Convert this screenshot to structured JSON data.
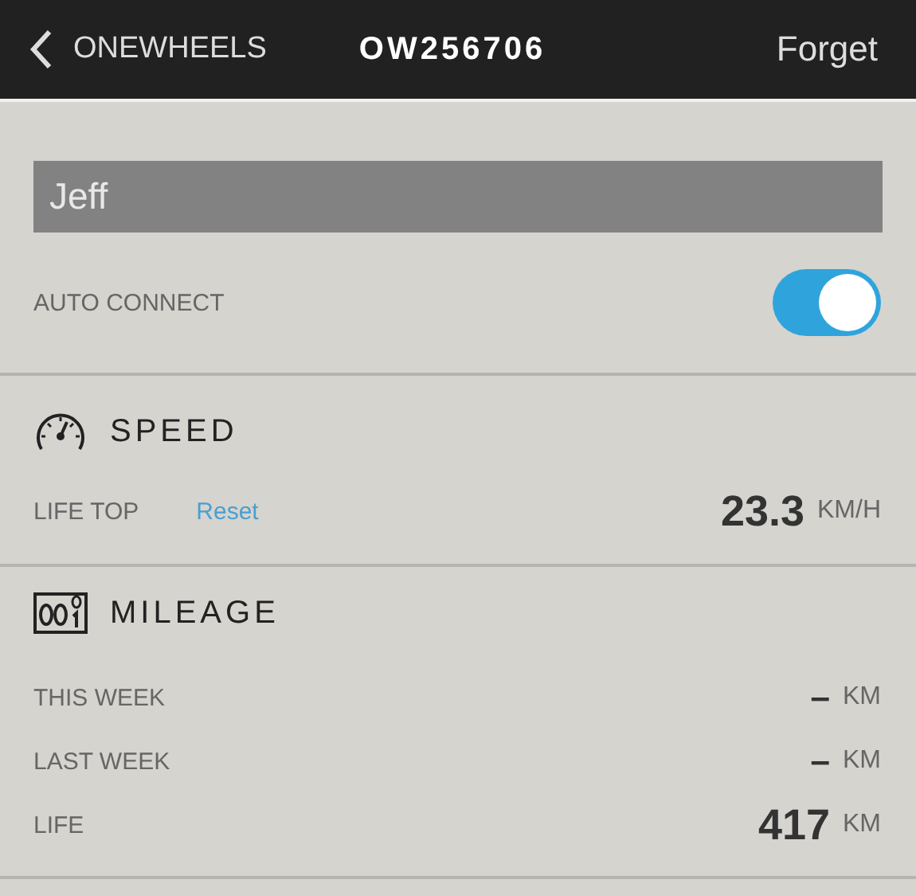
{
  "header": {
    "back_label": "ONEWHEELS",
    "title": "OW256706",
    "action": "Forget"
  },
  "name_field": {
    "value": "Jeff"
  },
  "auto_connect": {
    "label": "AUTO CONNECT",
    "on": true
  },
  "speed": {
    "title": "SPEED",
    "label": "LIFE TOP",
    "link": "Reset",
    "value": "23.3",
    "unit": "KM/H"
  },
  "mileage": {
    "title": "MILEAGE",
    "rows": [
      {
        "label": "THIS WEEK",
        "value": "–",
        "unit": "KM",
        "emphasis": false
      },
      {
        "label": "LAST WEEK",
        "value": "–",
        "unit": "KM",
        "emphasis": false
      },
      {
        "label": "LIFE",
        "value": "417",
        "unit": "KM",
        "emphasis": true
      }
    ]
  }
}
